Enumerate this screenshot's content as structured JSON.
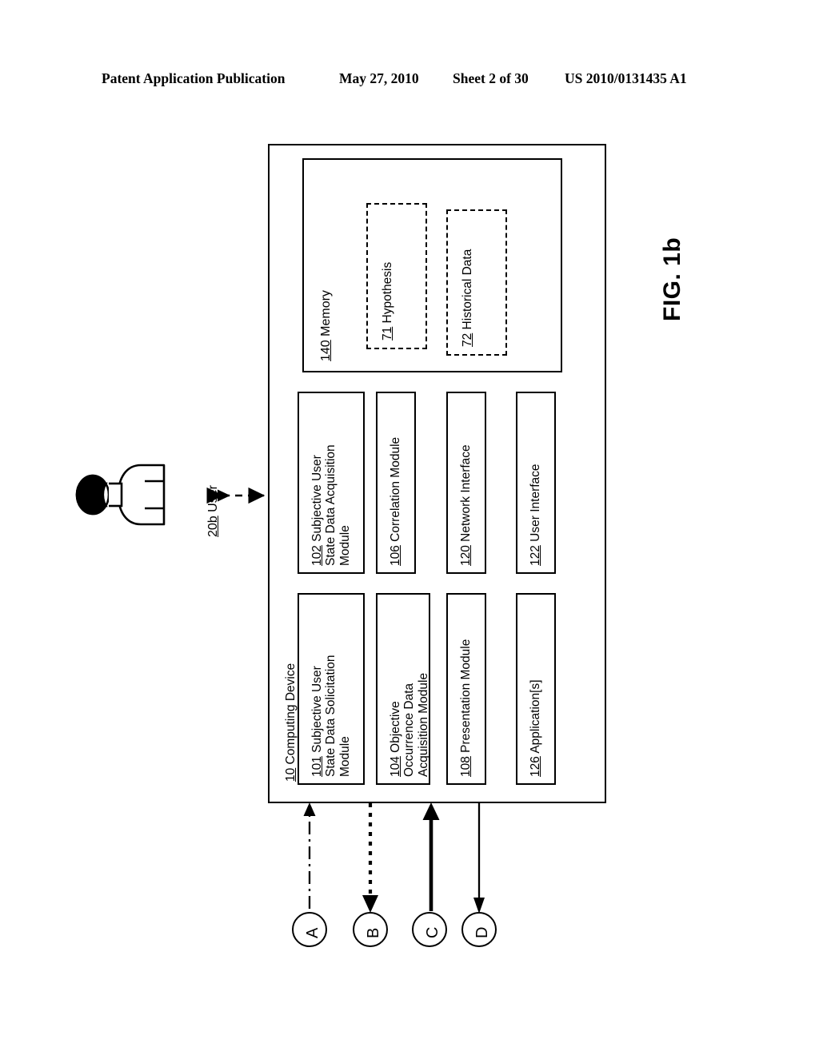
{
  "header": {
    "publication": "Patent Application Publication",
    "date": "May 27, 2010",
    "sheet": "Sheet 2 of 30",
    "patent_number": "US 2010/0131435 A1"
  },
  "figure": {
    "label": "FIG. 1b",
    "device": {
      "number": "10",
      "name": "Computing Device"
    },
    "user": {
      "number": "20b",
      "name": "User"
    },
    "memory": {
      "number": "140",
      "name": "Memory",
      "items": [
        {
          "number": "71",
          "name": "Hypothesis"
        },
        {
          "number": "72",
          "name": "Historical Data"
        }
      ]
    },
    "modules": [
      {
        "number": "102",
        "name": "Subjective User\nState Data Acquisition\nModule"
      },
      {
        "number": "106",
        "name": "Correlation Module"
      },
      {
        "number": "120",
        "name": "Network Interface"
      },
      {
        "number": "122",
        "name": "User Interface"
      },
      {
        "number": "101",
        "name": "Subjective User\nState Data Solicitation\nModule"
      },
      {
        "number": "104",
        "name": "Objective\nOccurrence Data\nAcquisition Module"
      },
      {
        "number": "108",
        "name": "Presentation Module"
      },
      {
        "number": "126",
        "name": "Application[s]"
      }
    ],
    "connectors": [
      {
        "label": "A",
        "line_style": "dash-dot",
        "direction": "to-device"
      },
      {
        "label": "B",
        "line_style": "dotted",
        "direction": "from-device"
      },
      {
        "label": "C",
        "line_style": "thick-solid",
        "direction": "to-device"
      },
      {
        "label": "D",
        "line_style": "solid",
        "direction": "from-device"
      }
    ]
  },
  "colors": {
    "ink": "#000000",
    "paper": "#ffffff"
  }
}
